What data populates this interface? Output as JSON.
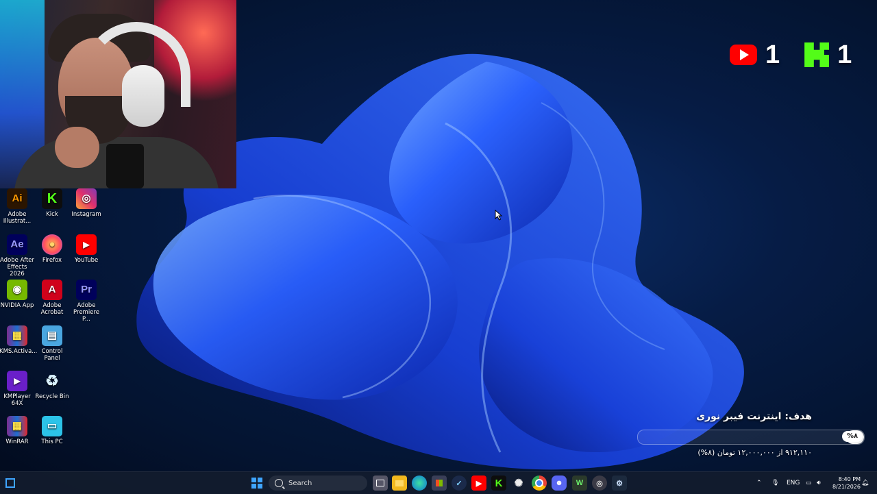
{
  "social": {
    "youtube_count": "1",
    "kick_count": "1"
  },
  "desktop_icons": [
    {
      "label": "Adobe Illustrat...",
      "glyph": "Ai",
      "icon": "illustrator-icon"
    },
    {
      "label": "Kick",
      "glyph": "K",
      "icon": "kick-icon"
    },
    {
      "label": "Instagram",
      "glyph": "◎",
      "icon": "instagram-icon"
    },
    {
      "label": "Adobe After Effects 2026",
      "glyph": "Ae",
      "icon": "after-effects-icon"
    },
    {
      "label": "Firefox",
      "glyph": "●",
      "icon": "firefox-icon"
    },
    {
      "label": "YouTube",
      "glyph": "▶",
      "icon": "youtube-icon"
    },
    {
      "label": "NVIDIA App",
      "glyph": "◉",
      "icon": "nvidia-icon"
    },
    {
      "label": "Adobe Acrobat",
      "glyph": "A",
      "icon": "acrobat-icon"
    },
    {
      "label": "Adobe Premiere P...",
      "glyph": "Pr",
      "icon": "premiere-icon"
    },
    {
      "label": "KMS.Activa...",
      "glyph": "▦",
      "icon": "winrar-archive-icon"
    },
    {
      "label": "Control Panel",
      "glyph": "▤",
      "icon": "control-panel-icon"
    },
    {
      "label": "KMPlayer 64X",
      "glyph": "▶",
      "icon": "kmplayer-icon"
    },
    {
      "label": "Recycle Bin",
      "glyph": "♻",
      "icon": "recycle-bin-icon"
    },
    {
      "label": "WinRAR",
      "glyph": "▦",
      "icon": "winrar-icon"
    },
    {
      "label": "This PC",
      "glyph": "▭",
      "icon": "this-pc-icon"
    }
  ],
  "goal": {
    "title": "هدف: اینترنت فیبر نوری",
    "percent_label": "%۸",
    "progress": 0.08,
    "subtitle": "۹۱۲,۱۱۰ از ۱۲,۰۰۰,۰۰۰ تومان (۸%)"
  },
  "taskbar": {
    "search_placeholder": "Search",
    "language": "ENG",
    "time": "8:40 PM",
    "date": "8/21/2026"
  },
  "colors": {
    "youtube": "#ff0000",
    "kick": "#53fc18",
    "windows_accent": "#3fa5ff"
  }
}
